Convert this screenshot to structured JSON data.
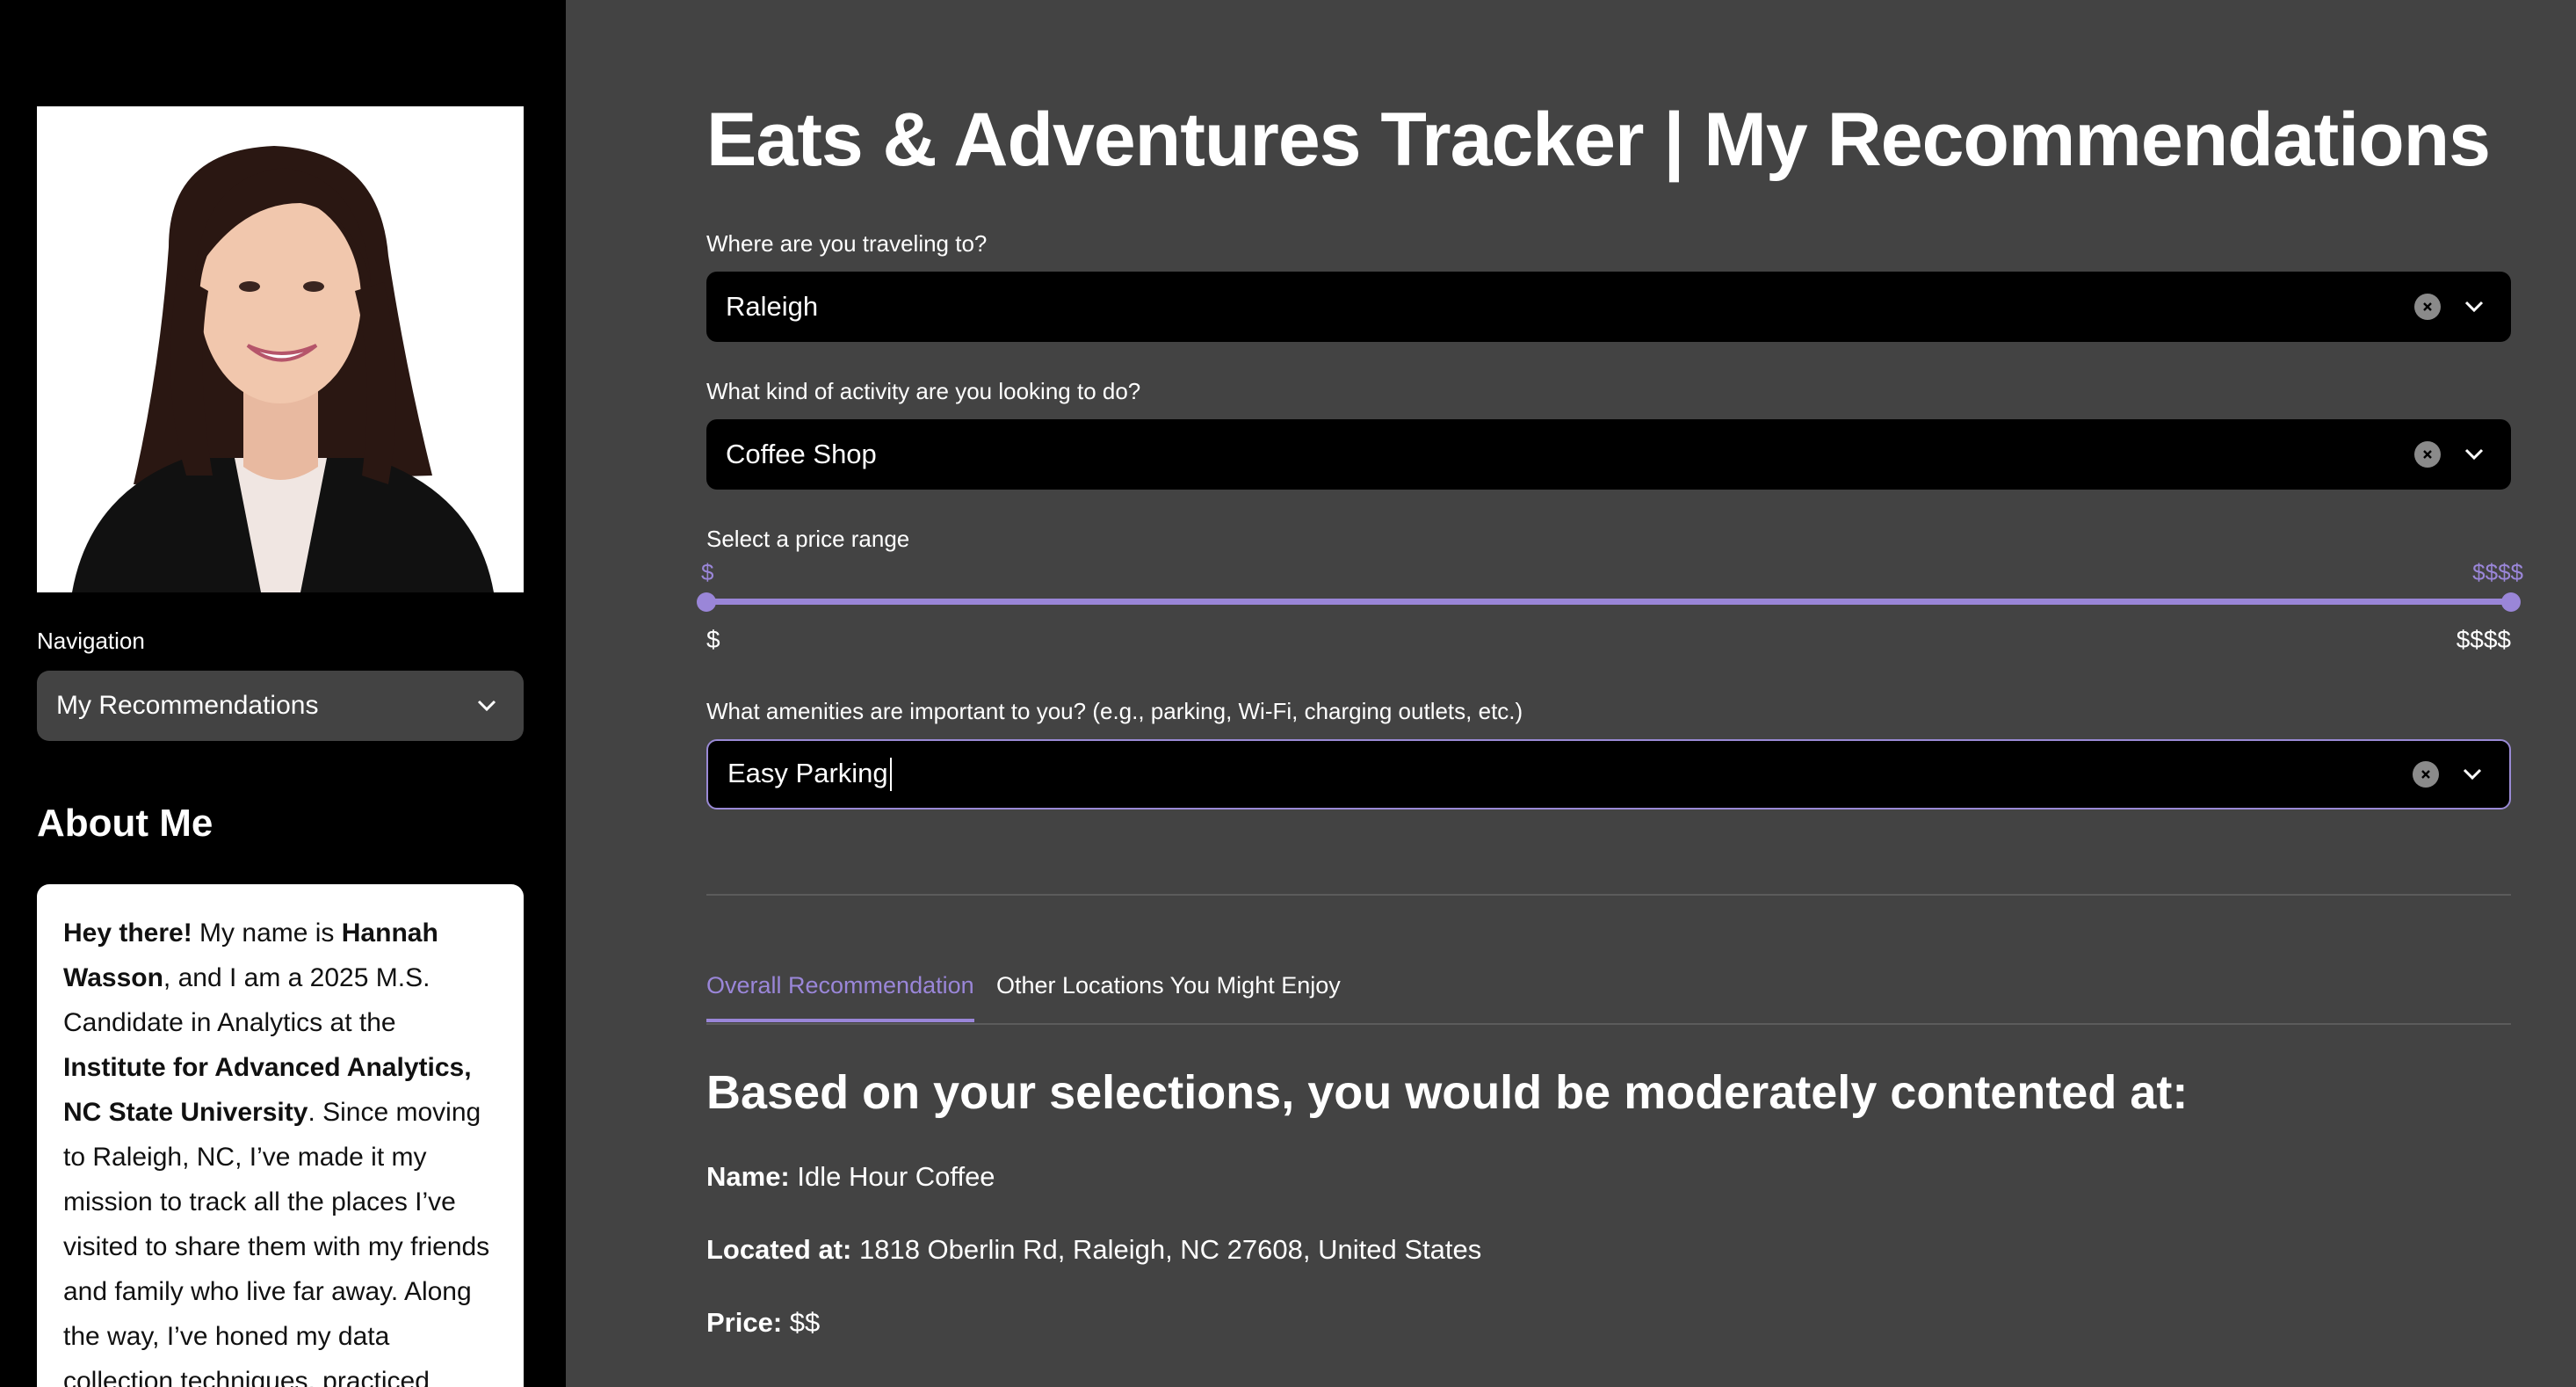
{
  "sidebar": {
    "navigation_label": "Navigation",
    "navigation_selected": "My Recommendations",
    "about_title": "About Me",
    "about": {
      "greeting": "Hey there!",
      "t1": " My name is ",
      "name": "Hannah Wasson",
      "t2": ", and I am a 2025 M.S. Candidate in Analytics at the ",
      "institute": "Institute for Advanced Analytics, NC State University",
      "t3": ". Since moving to Raleigh, NC, I’ve made it my mission to track all the places I’ve visited to share them with my friends and family who live far away. Along the way, I’ve honed my data collection techniques, practiced coding and"
    }
  },
  "main": {
    "title": "Eats & Adventures Tracker | My Recommendations",
    "destination": {
      "label": "Where are you traveling to?",
      "value": "Raleigh"
    },
    "activity": {
      "label": "What kind of activity are you looking to do?",
      "value": "Coffee Shop"
    },
    "price": {
      "label": "Select a price range",
      "selected_min": "$",
      "selected_max": "$$$$",
      "range_min": "$",
      "range_max": "$$$$",
      "selected_min_fraction": 0,
      "selected_max_fraction": 1
    },
    "amenities": {
      "label": "What amenities are important to you? (e.g., parking, Wi-Fi, charging outlets, etc.)",
      "value": "Easy Parking"
    },
    "tabs": [
      {
        "label": "Overall Recommendation",
        "active": true
      },
      {
        "label": "Other Locations You Might Enjoy",
        "active": false
      }
    ],
    "result": {
      "heading": "Based on your selections, you would be moderately contented at:",
      "name_key": "Name:",
      "name_value": " Idle Hour Coffee",
      "location_key": "Located at:",
      "location_value": " 1818 Oberlin Rd, Raleigh, NC 27608, United States",
      "price_key": "Price:",
      "price_value": " $$"
    }
  },
  "colors": {
    "accent": "#9a86d8",
    "sidebar_bg": "#000000",
    "main_bg": "#434343"
  }
}
